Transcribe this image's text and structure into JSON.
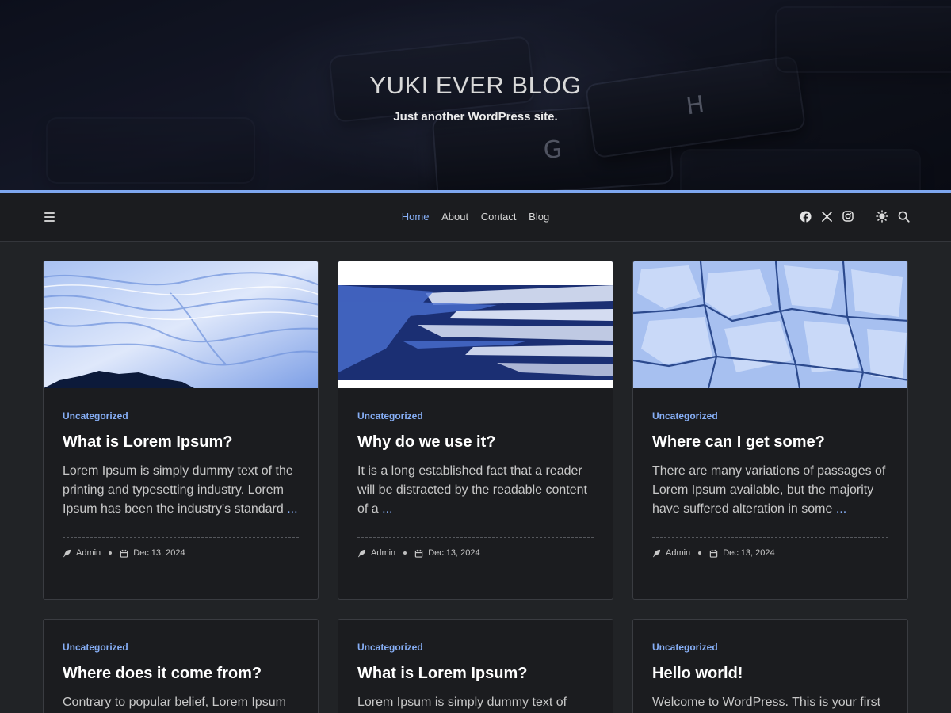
{
  "site": {
    "title": "YUKI EVER BLOG",
    "tagline": "Just another WordPress site."
  },
  "hero": {
    "keys": [
      "G",
      "H"
    ]
  },
  "nav": {
    "links": [
      "Home",
      "About",
      "Contact",
      "Blog"
    ],
    "active": "Home",
    "icons": [
      "menu-icon",
      "facebook-icon",
      "x-icon",
      "instagram-icon",
      "theme-toggle-icon",
      "search-icon"
    ]
  },
  "colors": {
    "accent": "#86aef5",
    "nav_border": "#7ea7ef",
    "background": "#212326",
    "card_bg": "#1b1c1f"
  },
  "posts": [
    {
      "category": "Uncategorized",
      "title": "What is Lorem Ipsum?",
      "excerpt": "Lorem Ipsum is simply dummy text of the printing and typesetting industry. Lorem Ipsum has been the industry's standard",
      "more": "...",
      "author": "Admin",
      "date": "Dec 13, 2024",
      "thumbnail": "blue-ice-swirl"
    },
    {
      "category": "Uncategorized",
      "title": "Why do we use it?",
      "excerpt": "It is a long established fact that a reader will be distracted by the readable content of a",
      "more": "...",
      "author": "Admin",
      "date": "Dec 13, 2024",
      "thumbnail": "blue-brush-strokes"
    },
    {
      "category": "Uncategorized",
      "title": "Where can I get some?",
      "excerpt": "There are many variations of passages of Lorem Ipsum available, but the majority have suffered alteration in some",
      "more": "...",
      "author": "Admin",
      "date": "Dec 13, 2024",
      "thumbnail": "cracked-ice"
    },
    {
      "category": "Uncategorized",
      "title": "Where does it come from?",
      "excerpt": "Contrary to popular belief, Lorem Ipsum"
    },
    {
      "category": "Uncategorized",
      "title": "What is Lorem Ipsum?",
      "excerpt": "Lorem Ipsum is simply dummy text of"
    },
    {
      "category": "Uncategorized",
      "title": "Hello world!",
      "excerpt": "Welcome to WordPress. This is your first"
    }
  ]
}
